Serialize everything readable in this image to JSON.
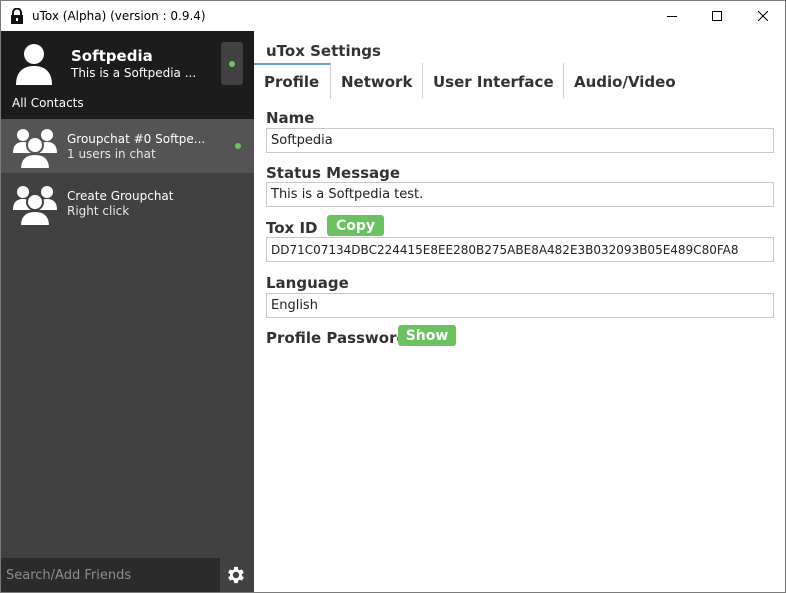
{
  "window": {
    "title": "uTox (Alpha) (version : 0.9.4)"
  },
  "sidebar": {
    "self": {
      "name": "Softpedia",
      "status_message": "This is a Softpedia ...",
      "status_color": "#6bc260"
    },
    "section_label": "All Contacts",
    "contacts": [
      {
        "name": "Groupchat #0 Softpe...",
        "subtitle": "1 users in chat",
        "online": true
      },
      {
        "name": "Create Groupchat",
        "subtitle": "Right click",
        "online": false
      }
    ],
    "search_placeholder": "Search/Add Friends"
  },
  "main": {
    "title": "uTox Settings",
    "tabs": [
      {
        "label": "Profile",
        "active": true
      },
      {
        "label": "Network",
        "active": false
      },
      {
        "label": "User Interface",
        "active": false
      },
      {
        "label": "Audio/Video",
        "active": false
      }
    ],
    "profile": {
      "name_label": "Name",
      "name_value": "Softpedia",
      "status_label": "Status Message",
      "status_value": "This is a Softpedia test.",
      "toxid_label": "Tox ID",
      "copy_button": "Copy",
      "toxid_value": "DD71C07134DBC224415E8EE280B275ABE8A482E3B032093B05E489C80FA8",
      "language_label": "Language",
      "language_value": "English",
      "password_label": "Profile Password",
      "show_button": "Show"
    }
  },
  "colors": {
    "accent_green": "#6bc260",
    "sidebar_bg": "#414141",
    "self_bg": "#1c1c1c",
    "active_tab": "#6a9fd5"
  },
  "icons": [
    "lock-icon",
    "minimize-icon",
    "maximize-icon",
    "close-icon",
    "user-avatar-icon",
    "group-avatar-icon",
    "gear-icon"
  ]
}
